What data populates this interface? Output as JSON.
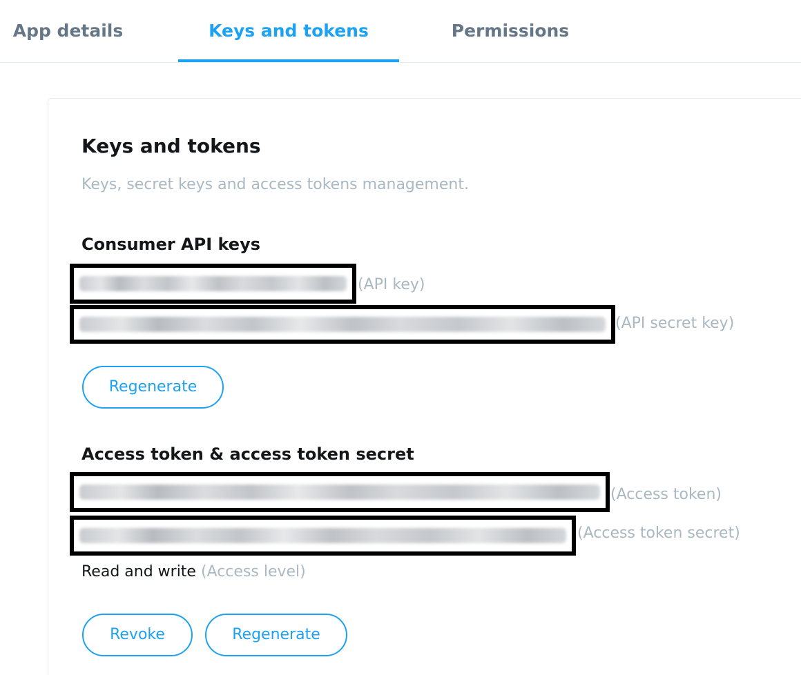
{
  "tabs": {
    "app_details": "App details",
    "keys_and_tokens": "Keys and tokens",
    "permissions": "Permissions"
  },
  "card": {
    "title": "Keys and tokens",
    "subtitle": "Keys, secret keys and access tokens management."
  },
  "consumer": {
    "title": "Consumer API keys",
    "api_key_hint": "(API key)",
    "api_secret_hint": "(API secret key)",
    "regenerate_label": "Regenerate"
  },
  "access": {
    "title": "Access token & access token secret",
    "access_token_hint": "(Access token)",
    "access_secret_hint": "(Access token secret)",
    "level_value": "Read and write",
    "level_hint": "(Access level)",
    "revoke_label": "Revoke",
    "regenerate_label": "Regenerate"
  },
  "colors": {
    "accent": "#1da1f2",
    "muted": "#aab8c2",
    "tab_inactive": "#657786",
    "text": "#14171a"
  }
}
